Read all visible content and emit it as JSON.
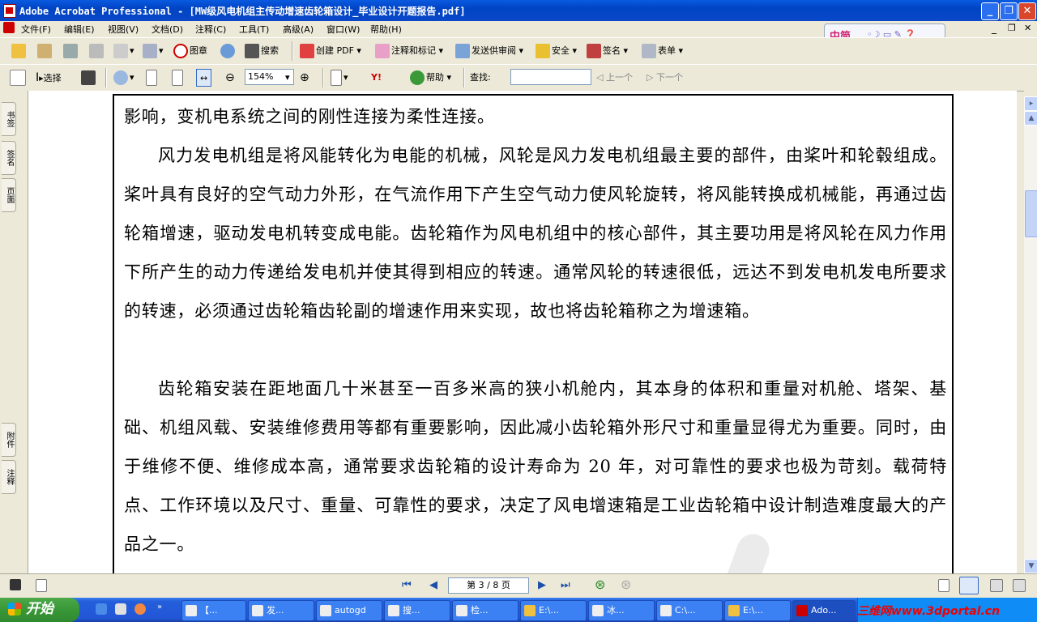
{
  "window": {
    "title": "Adobe Acrobat Professional - [MW级风电机组主传动增速齿轮箱设计_毕业设计开题报告.pdf]",
    "minimize": "_",
    "restore": "❐",
    "close": "✕"
  },
  "menu": [
    "文件(F)",
    "编辑(E)",
    "视图(V)",
    "文档(D)",
    "注释(C)",
    "工具(T)",
    "高级(A)",
    "窗口(W)",
    "帮助(H)"
  ],
  "ime": {
    "label": "中简"
  },
  "toolbar1": {
    "stamp": "图章",
    "search": "搜索",
    "create_pdf": "创建 PDF",
    "comment_markup": "注释和标记",
    "send_review": "发送供审阅",
    "secure": "安全",
    "sign": "签名",
    "forms": "表单"
  },
  "toolbar2": {
    "select": "选择",
    "zoom": "154%",
    "help": "帮助",
    "find_label": "查找:",
    "find_value": "",
    "prev": "上一个",
    "next": "下一个"
  },
  "side_tabs_top": [
    "书签",
    "签名",
    "页面"
  ],
  "side_tabs_bottom": [
    "附件",
    "注释"
  ],
  "document": {
    "p1": "影响，变机电系统之间的刚性连接为柔性连接。",
    "p2": "风力发电机组是将风能转化为电能的机械，风轮是风力发电机组最主要的部件，由桨叶和轮毂组成。桨叶具有良好的空气动力外形，在气流作用下产生空气动力使风轮旋转，将风能转换成机械能，再通过齿轮箱增速，驱动发电机转变成电能。齿轮箱作为风电机组中的核心部件，其主要功用是将风轮在风力作用下所产生的动力传递给发电机并使其得到相应的转速。通常风轮的转速很低，远达不到发电机发电所要求的转速，必须通过齿轮箱齿轮副的增速作用来实现，故也将齿轮箱称之为增速箱。",
    "p3": "齿轮箱安装在距地面几十米甚至一百多米高的狭小机舱内，其本身的体积和重量对机舱、塔架、基础、机组风载、安装维修费用等都有重要影响，因此减小齿轮箱外形尺寸和重量显得尤为重要。同时，由于维修不便、维修成本高，通常要求齿轮箱的设计寿命为 20 年，对可靠性的要求也极为苛刻。载荷特点、工作环境以及尺寸、重量、可靠性的要求，决定了风电增速箱是工业齿轮箱中设计制造难度最大的产品之一。"
  },
  "status": {
    "page": "第 3 / 8 页"
  },
  "taskbar": {
    "start": "开始",
    "tasks": [
      "【...",
      "发...",
      "autogd",
      "搜...",
      "检...",
      "E:\\...",
      "冰...",
      "C:\\...",
      "E:\\...",
      "Ado..."
    ],
    "watermark": "三维网www.3dportal.cn"
  }
}
